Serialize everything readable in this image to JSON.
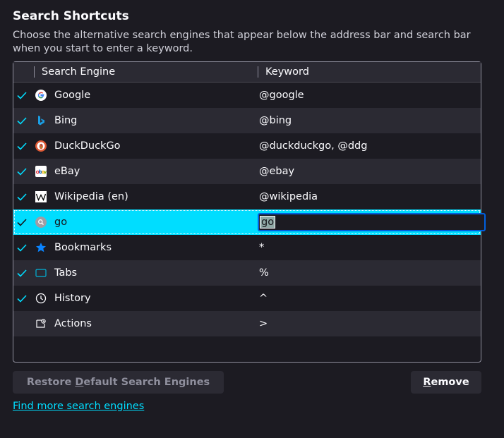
{
  "section": {
    "title": "Search Shortcuts",
    "description": "Choose the alternative search engines that appear below the address bar and search bar when you start to enter a keyword."
  },
  "table": {
    "columns": {
      "engine": "Search Engine",
      "keyword": "Keyword"
    },
    "rows": [
      {
        "name": "Google",
        "keyword": "@google",
        "checked": true,
        "icon": "google-icon"
      },
      {
        "name": "Bing",
        "keyword": "@bing",
        "checked": true,
        "icon": "bing-icon"
      },
      {
        "name": "DuckDuckGo",
        "keyword": "@duckduckgo, @ddg",
        "checked": true,
        "icon": "duckduckgo-icon"
      },
      {
        "name": "eBay",
        "keyword": "@ebay",
        "checked": true,
        "icon": "ebay-icon"
      },
      {
        "name": "Wikipedia (en)",
        "keyword": "@wikipedia",
        "checked": true,
        "icon": "wikipedia-icon"
      },
      {
        "name": "go",
        "keyword": "go",
        "checked": true,
        "icon": "search-engine-icon",
        "selected": true,
        "editing": true
      },
      {
        "name": "Bookmarks",
        "keyword": "*",
        "checked": true,
        "icon": "bookmark-star-icon"
      },
      {
        "name": "Tabs",
        "keyword": "%",
        "checked": true,
        "icon": "tab-icon"
      },
      {
        "name": "History",
        "keyword": "^",
        "checked": true,
        "icon": "clock-icon"
      },
      {
        "name": "Actions",
        "keyword": ">",
        "checked": false,
        "icon": "actions-icon"
      }
    ]
  },
  "buttons": {
    "restore_pre": "Restore ",
    "restore_accel": "D",
    "restore_post": "efault Search Engines",
    "remove_accel": "R",
    "remove_post": "emove"
  },
  "link": {
    "find_more": "Find more search engines"
  },
  "colors": {
    "background": "#1c1b22",
    "accent": "#00ddff",
    "row_alt": "#2b2a33",
    "check": "#00ddff"
  }
}
